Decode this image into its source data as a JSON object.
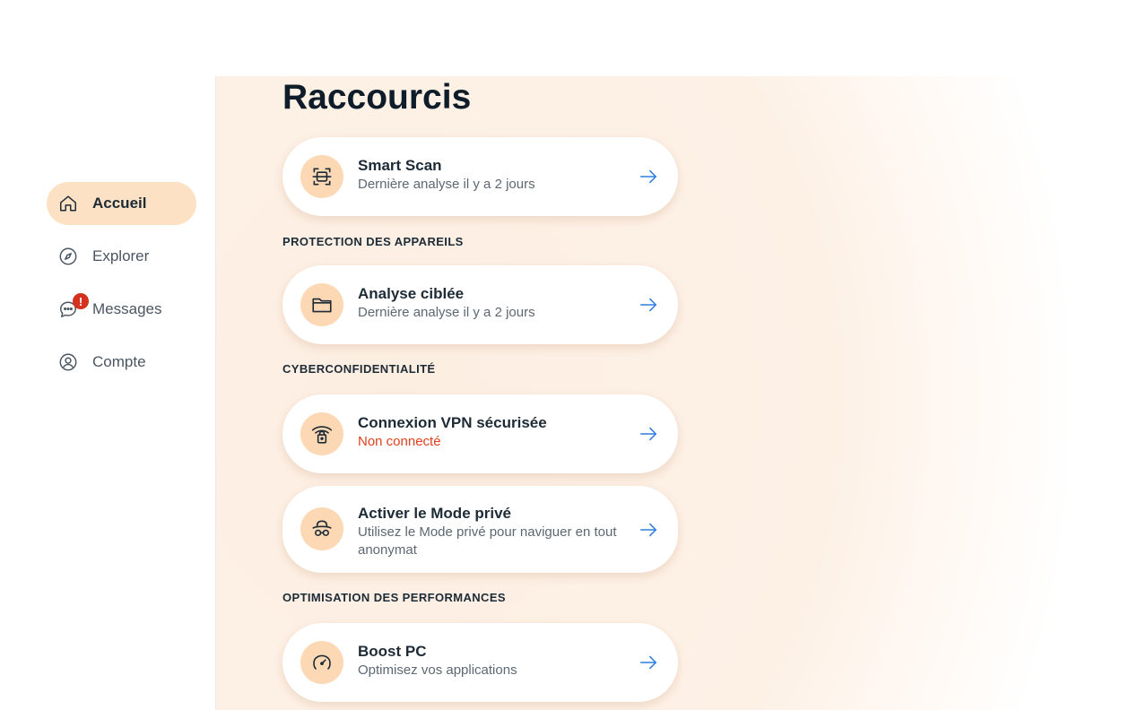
{
  "colors": {
    "accent": "#fde1c5",
    "icon_circle": "#fcd8b4",
    "arrow": "#2f7ee0",
    "alert": "#e0401f",
    "badge": "#d5311f"
  },
  "sidebar": {
    "items": [
      {
        "label": "Accueil",
        "icon": "home-icon",
        "active": true
      },
      {
        "label": "Explorer",
        "icon": "compass-icon",
        "active": false
      },
      {
        "label": "Messages",
        "icon": "chat-icon",
        "active": false,
        "badge": "!"
      },
      {
        "label": "Compte",
        "icon": "user-circle-icon",
        "active": false
      }
    ]
  },
  "main": {
    "title": "Raccourcis",
    "sections": [
      {
        "heading": "PROTECTION DES APPAREILS"
      },
      {
        "heading": "CYBERCONFIDENTIALITÉ"
      },
      {
        "heading": "OPTIMISATION DES PERFORMANCES"
      }
    ],
    "cards": [
      {
        "title": "Smart Scan",
        "subtitle": "Dernière analyse il y a 2 jours",
        "icon": "scan-icon"
      },
      {
        "title": "Analyse ciblée",
        "subtitle": "Dernière analyse il y a 2 jours",
        "icon": "folder-icon"
      },
      {
        "title": "Connexion VPN sécurisée",
        "subtitle": "Non connecté",
        "icon": "wifi-lock-icon"
      },
      {
        "title": "Activer le Mode privé",
        "subtitle": "Utilisez le Mode privé pour naviguer en tout anonymat",
        "icon": "incognito-icon"
      },
      {
        "title": "Boost PC",
        "subtitle": "Optimisez vos applications",
        "icon": "speedometer-icon"
      }
    ]
  }
}
